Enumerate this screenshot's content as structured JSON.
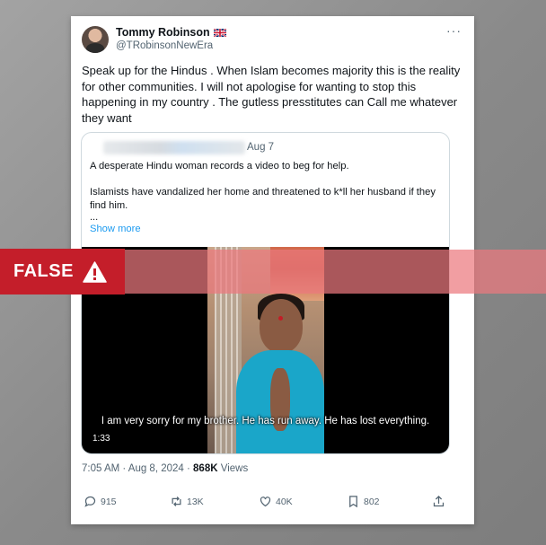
{
  "tweet": {
    "author_name": "Tommy Robinson",
    "author_handle": "@TRobinsonNewEra",
    "text": "Speak up for the Hindus . When Islam becomes majority this is the reality for other communities. I will not apologise for wanting to stop this happening in my country . The gutless presstitutes can Call me whatever they want",
    "more_menu": "···",
    "time": "7:05 AM · Aug 8, 2024 · ",
    "views_count": "868K",
    "views_label": " Views"
  },
  "quote": {
    "date": "Aug 7",
    "line1": "A desperate Hindu woman records a video to beg for help.",
    "line2": "Islamists have vandalized her home and threatened to k*ll her husband if they find him.",
    "ellipsis": "...",
    "show_more": "Show more",
    "video_subtitle": "I am very sorry for my brother. He has run away. He has lost everything.",
    "video_duration": "1:33"
  },
  "actions": {
    "replies": "915",
    "reposts": "13K",
    "likes": "40K",
    "bookmarks": "802"
  },
  "label": {
    "text": "FALSE"
  },
  "icons": [
    "uk-flag-icon",
    "more-icon",
    "reply-icon",
    "repost-icon",
    "like-icon",
    "bookmark-icon",
    "share-icon",
    "warning-icon"
  ],
  "colors": {
    "false_red": "#c41e2a",
    "link_blue": "#1d9bf0",
    "muted": "#536471"
  }
}
